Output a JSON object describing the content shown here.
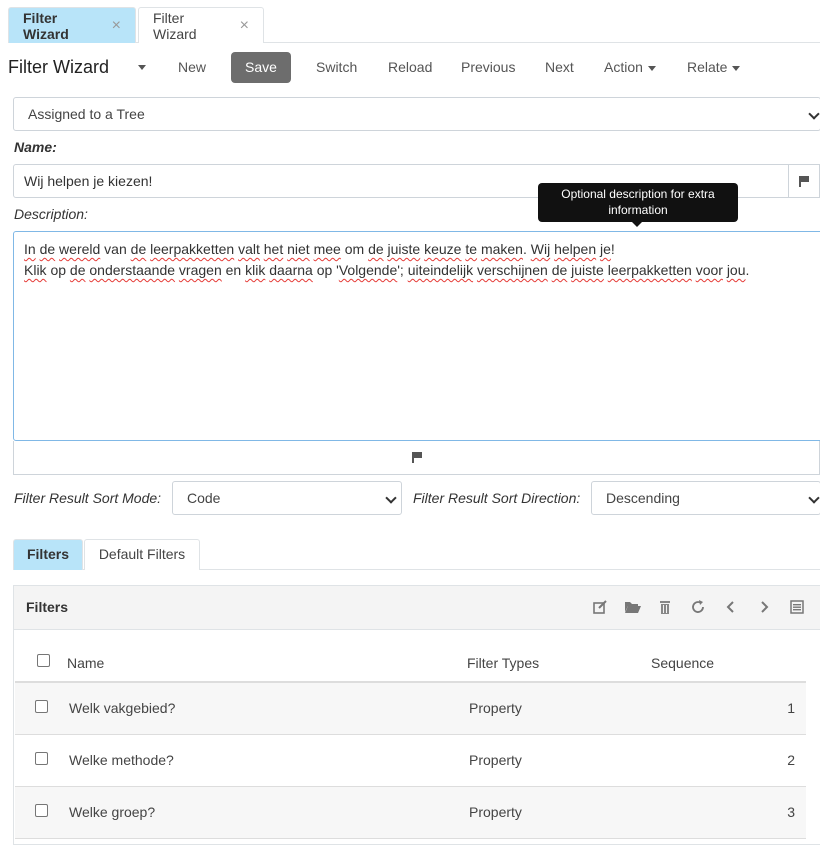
{
  "tabs": [
    {
      "label": "Filter Wizard",
      "close": "×"
    },
    {
      "label": "Filter Wizard",
      "close": "×"
    }
  ],
  "toolbar": {
    "title": "Filter Wizard",
    "new": "New",
    "save": "Save",
    "switch": "Switch",
    "reload": "Reload",
    "previous": "Previous",
    "next": "Next",
    "action": "Action",
    "relate": "Relate"
  },
  "form": {
    "type_select": "Assigned to a Tree",
    "name_label": "Name:",
    "name_value": "Wij helpen je kiezen!",
    "description_label": "Description:",
    "tooltip": "Optional description for extra information",
    "description_line1_parts": [
      "In",
      " ",
      "de",
      " ",
      "wereld",
      " van ",
      "de",
      " ",
      "leerpakketten",
      " ",
      "valt",
      " ",
      "het",
      " ",
      "niet",
      " ",
      "mee",
      " om ",
      "de",
      " ",
      "juiste",
      " ",
      "keuze",
      " ",
      "te",
      " ",
      "maken",
      ". ",
      "Wij",
      " ",
      "helpen",
      " ",
      "je",
      "!"
    ],
    "description_line2_parts": [
      "Klik",
      " op ",
      "de",
      " ",
      "onderstaande",
      " ",
      "vragen",
      " en ",
      "klik",
      " ",
      "daarna",
      " op '",
      "Volgende",
      "'; ",
      "uiteindelijk",
      " ",
      "verschijnen",
      " ",
      "de",
      " ",
      "juiste",
      " ",
      "leerpakketten",
      " ",
      "voor",
      " ",
      "jou",
      "."
    ],
    "sort_mode_label": "Filter Result Sort Mode:",
    "sort_mode_value": "Code",
    "sort_dir_label": "Filter Result Sort Direction:",
    "sort_dir_value": "Descending"
  },
  "inner_tabs": [
    "Filters",
    "Default Filters"
  ],
  "panel": {
    "title": "Filters",
    "icons": [
      "edit-icon",
      "folder-open-icon",
      "trash-icon",
      "refresh-icon",
      "chevron-left-icon",
      "chevron-right-icon",
      "list-icon"
    ]
  },
  "grid": {
    "columns": [
      "Name",
      "Filter Types",
      "Sequence"
    ],
    "rows": [
      {
        "name": "Welk vakgebied?",
        "type": "Property",
        "sequence": "1"
      },
      {
        "name": "Welke methode?",
        "type": "Property",
        "sequence": "2"
      },
      {
        "name": "Welke groep?",
        "type": "Property",
        "sequence": "3"
      }
    ]
  },
  "colors": {
    "active_tab": "#b8e4f9",
    "save_button": "#6d6d6d",
    "focus_border": "#80b8e6",
    "spell_error": "#e53935"
  }
}
